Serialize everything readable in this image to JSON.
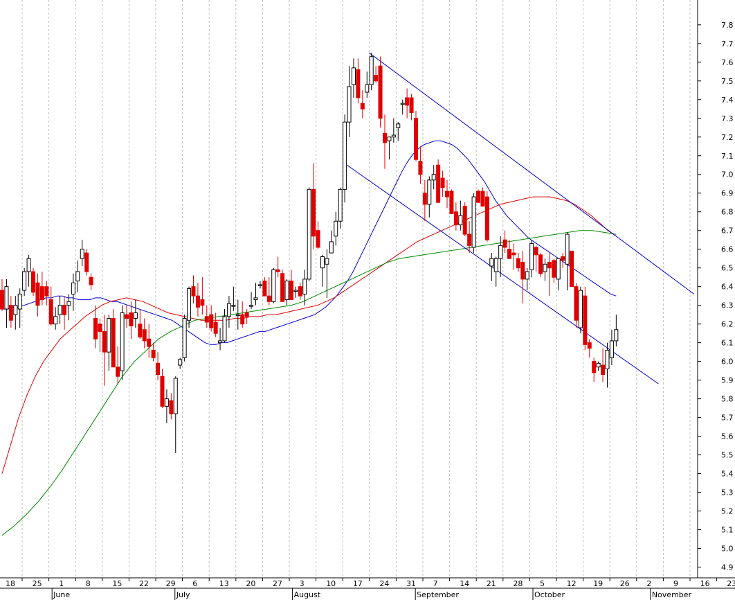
{
  "chart_data": {
    "type": "candlestick",
    "title": "",
    "xlabel": "",
    "ylabel": "",
    "ylim": [
      4.85,
      7.9
    ],
    "y_ticks": [
      4.9,
      5.0,
      5.1,
      5.2,
      5.3,
      5.4,
      5.5,
      5.6,
      5.7,
      5.8,
      5.9,
      6.0,
      6.1,
      6.2,
      6.3,
      6.4,
      6.5,
      6.6,
      6.7,
      6.8,
      6.9,
      7.0,
      7.1,
      7.2,
      7.3,
      7.4,
      7.5,
      7.6,
      7.7,
      7.8
    ],
    "y_tick_labels": [
      "4.9",
      "5.0",
      "5.1",
      "5.2",
      "5.3",
      "5.4",
      "5.5",
      "5.6",
      "5.7",
      "5.8",
      "5.9",
      "6.0",
      "6.1",
      "6.2",
      "6.3",
      "6.4",
      "6.5",
      "6.6",
      "6.7",
      "6.8",
      "6.9",
      "7.0",
      "7.1",
      "7.2",
      "7.3",
      "7.4",
      "7.5",
      "7.6",
      "7.7",
      "7.8"
    ],
    "week_labels": [
      "18",
      "25",
      "1",
      "8",
      "15",
      "22",
      "29",
      "6",
      "13",
      "20",
      "27",
      "3",
      "10",
      "17",
      "24",
      "31",
      "7",
      "14",
      "21",
      "28",
      "5",
      "12",
      "19",
      "26",
      "2",
      "9",
      "16",
      "23"
    ],
    "month_labels": [
      {
        "label": "June",
        "week": 2
      },
      {
        "label": "July",
        "week": 6.6
      },
      {
        "label": "August",
        "week": 11
      },
      {
        "label": "September",
        "week": 15.6
      },
      {
        "label": "October",
        "week": 20
      },
      {
        "label": "November",
        "week": 24.4
      }
    ],
    "grid": true,
    "candles": [
      [
        6.38,
        6.44,
        6.27,
        6.28
      ],
      [
        6.28,
        6.44,
        6.18,
        6.4
      ],
      [
        6.3,
        6.35,
        6.18,
        6.22
      ],
      [
        6.25,
        6.35,
        6.17,
        6.3
      ],
      [
        6.28,
        6.39,
        6.18,
        6.36
      ],
      [
        6.38,
        6.5,
        6.35,
        6.48
      ],
      [
        6.48,
        6.57,
        6.4,
        6.55
      ],
      [
        6.48,
        6.5,
        6.35,
        6.37
      ],
      [
        6.42,
        6.47,
        6.24,
        6.3
      ],
      [
        6.4,
        6.48,
        6.3,
        6.33
      ],
      [
        6.4,
        6.43,
        6.3,
        6.35
      ],
      [
        6.33,
        6.4,
        6.19,
        6.2
      ],
      [
        6.2,
        6.29,
        6.17,
        6.24
      ],
      [
        6.25,
        6.35,
        6.2,
        6.3
      ],
      [
        6.3,
        6.35,
        6.17,
        6.25
      ],
      [
        6.3,
        6.36,
        6.22,
        6.32
      ],
      [
        6.36,
        6.47,
        6.27,
        6.42
      ],
      [
        6.43,
        6.54,
        6.37,
        6.48
      ],
      [
        6.55,
        6.65,
        6.51,
        6.6
      ],
      [
        6.58,
        6.6,
        6.46,
        6.48
      ],
      [
        6.45,
        6.47,
        6.38,
        6.41
      ],
      [
        6.23,
        6.3,
        6.07,
        6.12
      ],
      [
        6.2,
        6.23,
        6.05,
        6.16
      ],
      [
        6.16,
        6.25,
        5.87,
        6.05
      ],
      [
        6.05,
        6.25,
        5.95,
        6.23
      ],
      [
        6.23,
        6.28,
        5.98,
        5.97
      ],
      [
        5.97,
        6.08,
        5.88,
        5.92
      ],
      [
        5.95,
        6.3,
        5.9,
        6.26
      ],
      [
        6.25,
        6.3,
        6.18,
        6.23
      ],
      [
        6.26,
        6.32,
        6.12,
        6.19
      ],
      [
        6.23,
        6.33,
        6.18,
        6.26
      ],
      [
        6.2,
        6.28,
        6.12,
        6.13
      ],
      [
        6.17,
        6.23,
        6.07,
        6.11
      ],
      [
        6.12,
        6.2,
        6.02,
        6.08
      ],
      [
        6.06,
        6.1,
        6.0,
        6.02
      ],
      [
        5.99,
        6.05,
        5.9,
        5.93
      ],
      [
        5.92,
        5.96,
        5.75,
        5.76
      ],
      [
        5.76,
        5.85,
        5.67,
        5.8
      ],
      [
        5.79,
        5.83,
        5.69,
        5.72
      ],
      [
        5.72,
        5.92,
        5.51,
        5.91
      ],
      [
        5.98,
        6.02,
        5.96,
        6.01
      ],
      [
        6.02,
        6.25,
        6.0,
        6.23
      ],
      [
        6.22,
        6.4,
        6.18,
        6.39
      ],
      [
        6.4,
        6.46,
        6.31,
        6.35
      ],
      [
        6.35,
        6.42,
        6.24,
        6.29
      ],
      [
        6.33,
        6.45,
        6.25,
        6.3
      ],
      [
        6.24,
        6.3,
        6.18,
        6.21
      ],
      [
        6.25,
        6.3,
        6.16,
        6.18
      ],
      [
        6.21,
        6.26,
        6.13,
        6.15
      ],
      [
        6.1,
        6.18,
        6.06,
        6.11
      ],
      [
        6.11,
        6.28,
        6.1,
        6.24
      ],
      [
        6.24,
        6.35,
        6.18,
        6.31
      ],
      [
        6.3,
        6.4,
        6.27,
        6.3
      ],
      [
        6.25,
        6.33,
        6.17,
        6.25
      ],
      [
        6.25,
        6.32,
        6.18,
        6.2
      ],
      [
        6.26,
        6.28,
        6.2,
        6.24
      ],
      [
        6.3,
        6.37,
        6.28,
        6.3
      ],
      [
        6.33,
        6.42,
        6.3,
        6.34
      ],
      [
        6.41,
        6.43,
        6.39,
        6.41
      ],
      [
        6.43,
        6.45,
        6.36,
        6.35
      ],
      [
        6.35,
        6.45,
        6.3,
        6.32
      ],
      [
        6.32,
        6.5,
        6.31,
        6.49
      ],
      [
        6.49,
        6.56,
        6.45,
        6.48
      ],
      [
        6.47,
        6.49,
        6.38,
        6.32
      ],
      [
        6.33,
        6.44,
        6.3,
        6.43
      ],
      [
        6.43,
        6.49,
        6.33,
        6.33
      ],
      [
        6.38,
        6.4,
        6.34,
        6.38
      ],
      [
        6.4,
        6.42,
        6.33,
        6.35
      ],
      [
        6.36,
        6.49,
        6.3,
        6.44
      ],
      [
        6.44,
        6.93,
        6.43,
        6.92
      ],
      [
        6.92,
        7.06,
        6.6,
        6.67
      ],
      [
        6.7,
        6.75,
        6.6,
        6.61
      ],
      [
        6.5,
        6.57,
        6.4,
        6.56
      ],
      [
        6.52,
        6.6,
        6.34,
        6.55
      ],
      [
        6.58,
        6.7,
        6.58,
        6.64
      ],
      [
        6.67,
        6.8,
        6.62,
        6.75
      ],
      [
        6.75,
        6.93,
        6.71,
        6.92
      ],
      [
        6.92,
        7.32,
        6.85,
        7.28
      ],
      [
        7.28,
        7.58,
        7.2,
        7.47
      ],
      [
        7.48,
        7.62,
        7.41,
        7.57
      ],
      [
        7.56,
        7.62,
        7.38,
        7.41
      ],
      [
        7.38,
        7.45,
        7.3,
        7.35
      ],
      [
        7.44,
        7.55,
        7.41,
        7.48
      ],
      [
        7.48,
        7.65,
        7.45,
        7.63
      ],
      [
        7.53,
        7.58,
        7.49,
        7.5
      ],
      [
        7.58,
        7.63,
        7.25,
        7.3
      ],
      [
        7.22,
        7.32,
        7.03,
        7.17
      ],
      [
        7.18,
        7.2,
        7.08,
        7.2
      ],
      [
        7.2,
        7.3,
        7.17,
        7.21
      ],
      [
        7.25,
        7.28,
        7.18,
        7.27
      ],
      [
        7.38,
        7.4,
        7.32,
        7.38
      ],
      [
        7.41,
        7.46,
        7.3,
        7.37
      ],
      [
        7.41,
        7.43,
        7.29,
        7.33
      ],
      [
        7.3,
        7.34,
        7.07,
        7.08
      ],
      [
        7.07,
        7.15,
        6.95,
        7.0
      ],
      [
        6.9,
        6.97,
        6.75,
        6.84
      ],
      [
        6.84,
        6.99,
        6.77,
        6.97
      ],
      [
        6.97,
        7.05,
        6.92,
        7.0
      ],
      [
        7.05,
        7.08,
        6.88,
        6.85
      ],
      [
        6.98,
        7.02,
        6.88,
        6.93
      ],
      [
        6.91,
        6.97,
        6.82,
        6.88
      ],
      [
        6.91,
        6.92,
        6.79,
        6.79
      ],
      [
        6.8,
        6.85,
        6.7,
        6.73
      ],
      [
        6.73,
        6.86,
        6.7,
        6.78
      ],
      [
        6.83,
        6.85,
        6.67,
        6.68
      ],
      [
        6.68,
        6.75,
        6.58,
        6.62
      ],
      [
        6.61,
        6.9,
        6.58,
        6.88
      ],
      [
        6.91,
        6.92,
        6.85,
        6.85
      ],
      [
        6.91,
        6.93,
        6.83,
        6.83
      ],
      [
        6.88,
        6.91,
        6.64,
        6.65
      ],
      [
        6.51,
        6.58,
        6.43,
        6.55
      ],
      [
        6.48,
        6.56,
        6.4,
        6.55
      ],
      [
        6.55,
        6.67,
        6.45,
        6.62
      ],
      [
        6.65,
        6.7,
        6.58,
        6.61
      ],
      [
        6.6,
        6.65,
        6.55,
        6.55
      ],
      [
        6.58,
        6.63,
        6.49,
        6.57
      ],
      [
        6.55,
        6.58,
        6.48,
        6.5
      ],
      [
        6.53,
        6.59,
        6.31,
        6.44
      ],
      [
        6.44,
        6.5,
        6.38,
        6.48
      ],
      [
        6.49,
        6.65,
        6.45,
        6.63
      ],
      [
        6.61,
        6.62,
        6.48,
        6.57
      ],
      [
        6.57,
        6.58,
        6.45,
        6.47
      ],
      [
        6.48,
        6.55,
        6.43,
        6.52
      ],
      [
        6.53,
        6.58,
        6.35,
        6.5
      ],
      [
        6.54,
        6.55,
        6.42,
        6.45
      ],
      [
        6.44,
        6.52,
        6.38,
        6.55
      ],
      [
        6.56,
        6.58,
        6.5,
        6.54
      ],
      [
        6.52,
        6.69,
        6.38,
        6.68
      ],
      [
        6.59,
        6.57,
        6.43,
        6.4
      ],
      [
        6.4,
        6.42,
        6.18,
        6.22
      ],
      [
        6.18,
        6.4,
        6.15,
        6.38
      ],
      [
        6.35,
        6.4,
        6.06,
        6.09
      ],
      [
        6.1,
        6.12,
        6.02,
        6.07
      ],
      [
        6.0,
        6.02,
        5.89,
        5.94
      ],
      [
        5.97,
        6.0,
        5.95,
        5.99
      ],
      [
        5.98,
        6.07,
        5.89,
        5.93
      ],
      [
        5.96,
        6.1,
        5.86,
        6.06
      ],
      [
        6.02,
        6.17,
        5.98,
        6.11
      ],
      [
        6.11,
        6.25,
        6.08,
        6.17
      ]
    ],
    "series": [
      {
        "color": "#0000dd",
        "values": [
          6.28,
          6.28,
          6.29,
          6.29,
          6.3,
          6.31,
          6.32,
          6.33,
          6.34,
          6.34,
          6.35,
          6.35,
          6.34,
          6.34,
          6.33,
          6.33,
          6.33,
          6.34,
          6.34,
          6.33,
          6.32,
          6.32,
          6.31,
          6.3,
          6.29,
          6.28,
          6.27,
          6.26,
          6.25,
          6.24,
          6.23,
          6.22,
          6.2,
          6.18,
          6.16,
          6.14,
          6.12,
          6.1,
          6.09,
          6.09,
          6.1,
          6.1,
          6.11,
          6.12,
          6.13,
          6.14,
          6.15,
          6.16,
          6.16,
          6.17,
          6.18,
          6.19,
          6.2,
          6.21,
          6.22,
          6.23,
          6.24,
          6.25,
          6.27,
          6.29,
          6.32,
          6.35,
          6.39,
          6.43,
          6.48,
          6.54,
          6.6,
          6.66,
          6.72,
          6.78,
          6.84,
          6.9,
          6.96,
          7.02,
          7.07,
          7.11,
          7.14,
          7.16,
          7.17,
          7.18,
          7.18,
          7.17,
          7.16,
          7.14,
          7.11,
          7.08,
          7.04,
          7.0,
          6.96,
          6.91,
          6.86,
          6.82,
          6.78,
          6.75,
          6.72,
          6.69,
          6.66,
          6.64,
          6.62,
          6.6,
          6.58,
          6.56,
          6.54,
          6.52,
          6.5,
          6.48,
          6.46,
          6.44,
          6.42,
          6.4,
          6.38,
          6.36,
          6.35
        ]
      },
      {
        "color": "#dd0000",
        "values": [
          5.4,
          5.55,
          5.7,
          5.82,
          5.92,
          6.0,
          6.06,
          6.12,
          6.16,
          6.2,
          6.24,
          6.27,
          6.3,
          6.32,
          6.33,
          6.34,
          6.33,
          6.32,
          6.3,
          6.28,
          6.26,
          6.25,
          6.24,
          6.23,
          6.22,
          6.22,
          6.22,
          6.22,
          6.23,
          6.23,
          6.24,
          6.24,
          6.25,
          6.25,
          6.26,
          6.27,
          6.28,
          6.29,
          6.3,
          6.32,
          6.34,
          6.37,
          6.4,
          6.43,
          6.46,
          6.49,
          6.52,
          6.55,
          6.58,
          6.61,
          6.64,
          6.66,
          6.68,
          6.7,
          6.72,
          6.74,
          6.76,
          6.78,
          6.8,
          6.82,
          6.84,
          6.85,
          6.86,
          6.87,
          6.88,
          6.88,
          6.88,
          6.87,
          6.86,
          6.84,
          6.81,
          6.78,
          6.74,
          6.7,
          6.67
        ]
      },
      {
        "color": "#008800",
        "values": [
          5.07,
          5.12,
          5.18,
          5.25,
          5.33,
          5.42,
          5.52,
          5.62,
          5.72,
          5.82,
          5.92,
          6.0,
          6.06,
          6.12,
          6.16,
          6.19,
          6.22,
          6.23,
          6.24,
          6.25,
          6.26,
          6.27,
          6.28,
          6.29,
          6.3,
          6.32,
          6.35,
          6.38,
          6.41,
          6.44,
          6.47,
          6.5,
          6.53,
          6.55,
          6.56,
          6.57,
          6.58,
          6.59,
          6.6,
          6.61,
          6.62,
          6.63,
          6.64,
          6.65,
          6.66,
          6.67,
          6.68,
          6.69,
          6.7,
          6.7,
          6.69,
          6.68
        ]
      }
    ],
    "trendlines": [
      {
        "color": "#0000cc",
        "from": [
          82.5,
          7.65
        ],
        "to": [
          155.5,
          6.36
        ]
      },
      {
        "color": "#0000cc",
        "from": [
          77.5,
          7.05
        ],
        "to": [
          147.5,
          5.88
        ]
      }
    ]
  }
}
